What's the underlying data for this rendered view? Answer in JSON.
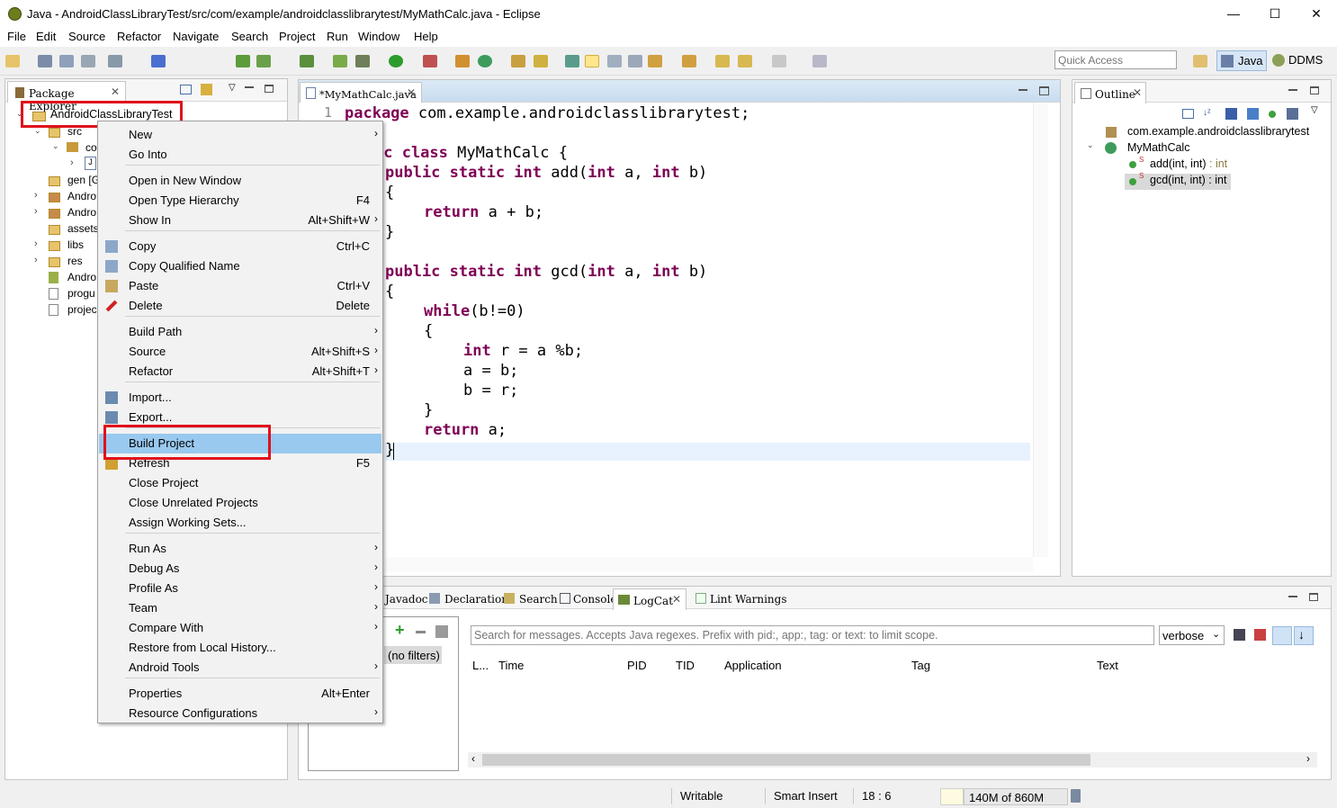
{
  "window": {
    "title": "Java - AndroidClassLibraryTest/src/com/example/androidclasslibrarytest/MyMathCalc.java - Eclipse",
    "minimize": "—",
    "maximize": "☐",
    "close": "✕"
  },
  "menubar": [
    "File",
    "Edit",
    "Source",
    "Refactor",
    "Navigate",
    "Search",
    "Project",
    "Run",
    "Window",
    "Help"
  ],
  "toolbar": {
    "quick_access_placeholder": "Quick Access",
    "perspective_java": "Java",
    "perspective_ddms": "DDMS"
  },
  "package_explorer": {
    "tab": "Package Explorer",
    "project": "AndroidClassLibraryTest",
    "items": [
      "src",
      "co",
      "J",
      "gen [G",
      "Andro",
      "Andro",
      "assets",
      "libs",
      "res",
      "Andro",
      "progu",
      "projec"
    ]
  },
  "editor": {
    "tab": "*MyMathCalc.java",
    "line1_no": "1",
    "code": {
      "l1_kw": "package",
      "l1": " com.example.androidclasslibrarytest;",
      "l2_kw": "ic class",
      "l2": " MyMathCalc {",
      "l3_kw1": "public static int",
      "l3a": " add(",
      "l3_kw2": "int",
      "l3b": " a, ",
      "l3_kw3": "int",
      "l3c": " b)",
      "l4": "{",
      "l5_kw": "return",
      "l5": " a + b;",
      "l6": "}",
      "l7_kw1": "public static int",
      "l7a": " gcd(",
      "l7_kw2": "int",
      "l7b": " a, ",
      "l7_kw3": "int",
      "l7c": " b)",
      "l8": "{",
      "l9_kw": "while",
      "l9": "(b!=0)",
      "l10": "{",
      "l11_kw": "int",
      "l11": " r = a %b;",
      "l12": "a = b;",
      "l13": "b = r;",
      "l14": "}",
      "l15_kw": "return",
      "l15": " a;",
      "l16": "}"
    }
  },
  "outline": {
    "tab": "Outline",
    "package": "com.example.androidclasslibrarytest",
    "class": "MyMathCalc",
    "methods": [
      {
        "name": "add(int, int)",
        "type": " : int",
        "mod": "S"
      },
      {
        "name": "gcd(int, int) : int",
        "type": "",
        "mod": "S"
      }
    ]
  },
  "bottom": {
    "tabs": [
      "Javadoc",
      "Declaration",
      "Search",
      "Console",
      "LogCat",
      "Lint Warnings"
    ],
    "filters": "(no filters)",
    "search_placeholder": "Search for messages. Accepts Java regexes. Prefix with pid:, app:, tag: or text: to limit scope.",
    "level": "verbose",
    "columns": [
      "L...",
      "Time",
      "PID",
      "TID",
      "Application",
      "Tag",
      "Text"
    ]
  },
  "context_menu": [
    {
      "label": "New",
      "acc": "",
      "sub": true
    },
    {
      "label": "Go Into",
      "acc": ""
    },
    {
      "label": "Open in New Window",
      "acc": ""
    },
    {
      "label": "Open Type Hierarchy",
      "acc": "F4"
    },
    {
      "label": "Show In",
      "acc": "Alt+Shift+W",
      "sub": true
    },
    {
      "label": "Copy",
      "acc": "Ctrl+C"
    },
    {
      "label": "Copy Qualified Name",
      "acc": ""
    },
    {
      "label": "Paste",
      "acc": "Ctrl+V"
    },
    {
      "label": "Delete",
      "acc": "Delete"
    },
    {
      "label": "Build Path",
      "acc": "",
      "sub": true
    },
    {
      "label": "Source",
      "acc": "Alt+Shift+S",
      "sub": true
    },
    {
      "label": "Refactor",
      "acc": "Alt+Shift+T",
      "sub": true
    },
    {
      "label": "Import...",
      "acc": ""
    },
    {
      "label": "Export...",
      "acc": ""
    },
    {
      "label": "Build Project",
      "acc": ""
    },
    {
      "label": "Refresh",
      "acc": "F5"
    },
    {
      "label": "Close Project",
      "acc": ""
    },
    {
      "label": "Close Unrelated Projects",
      "acc": ""
    },
    {
      "label": "Assign Working Sets...",
      "acc": ""
    },
    {
      "label": "Run As",
      "acc": "",
      "sub": true
    },
    {
      "label": "Debug As",
      "acc": "",
      "sub": true
    },
    {
      "label": "Profile As",
      "acc": "",
      "sub": true
    },
    {
      "label": "Team",
      "acc": "",
      "sub": true
    },
    {
      "label": "Compare With",
      "acc": "",
      "sub": true
    },
    {
      "label": "Restore from Local History...",
      "acc": ""
    },
    {
      "label": "Android Tools",
      "acc": "",
      "sub": true
    },
    {
      "label": "Properties",
      "acc": "Alt+Enter"
    },
    {
      "label": "Resource Configurations",
      "acc": "",
      "sub": true
    }
  ],
  "status": {
    "writable": "Writable",
    "insert": "Smart Insert",
    "position": "18 : 6",
    "memory": "140M of 860M"
  },
  "colors": {
    "highlight": "#99c9ef",
    "red_box": "#e0111b",
    "keyword": "#7f0055"
  }
}
